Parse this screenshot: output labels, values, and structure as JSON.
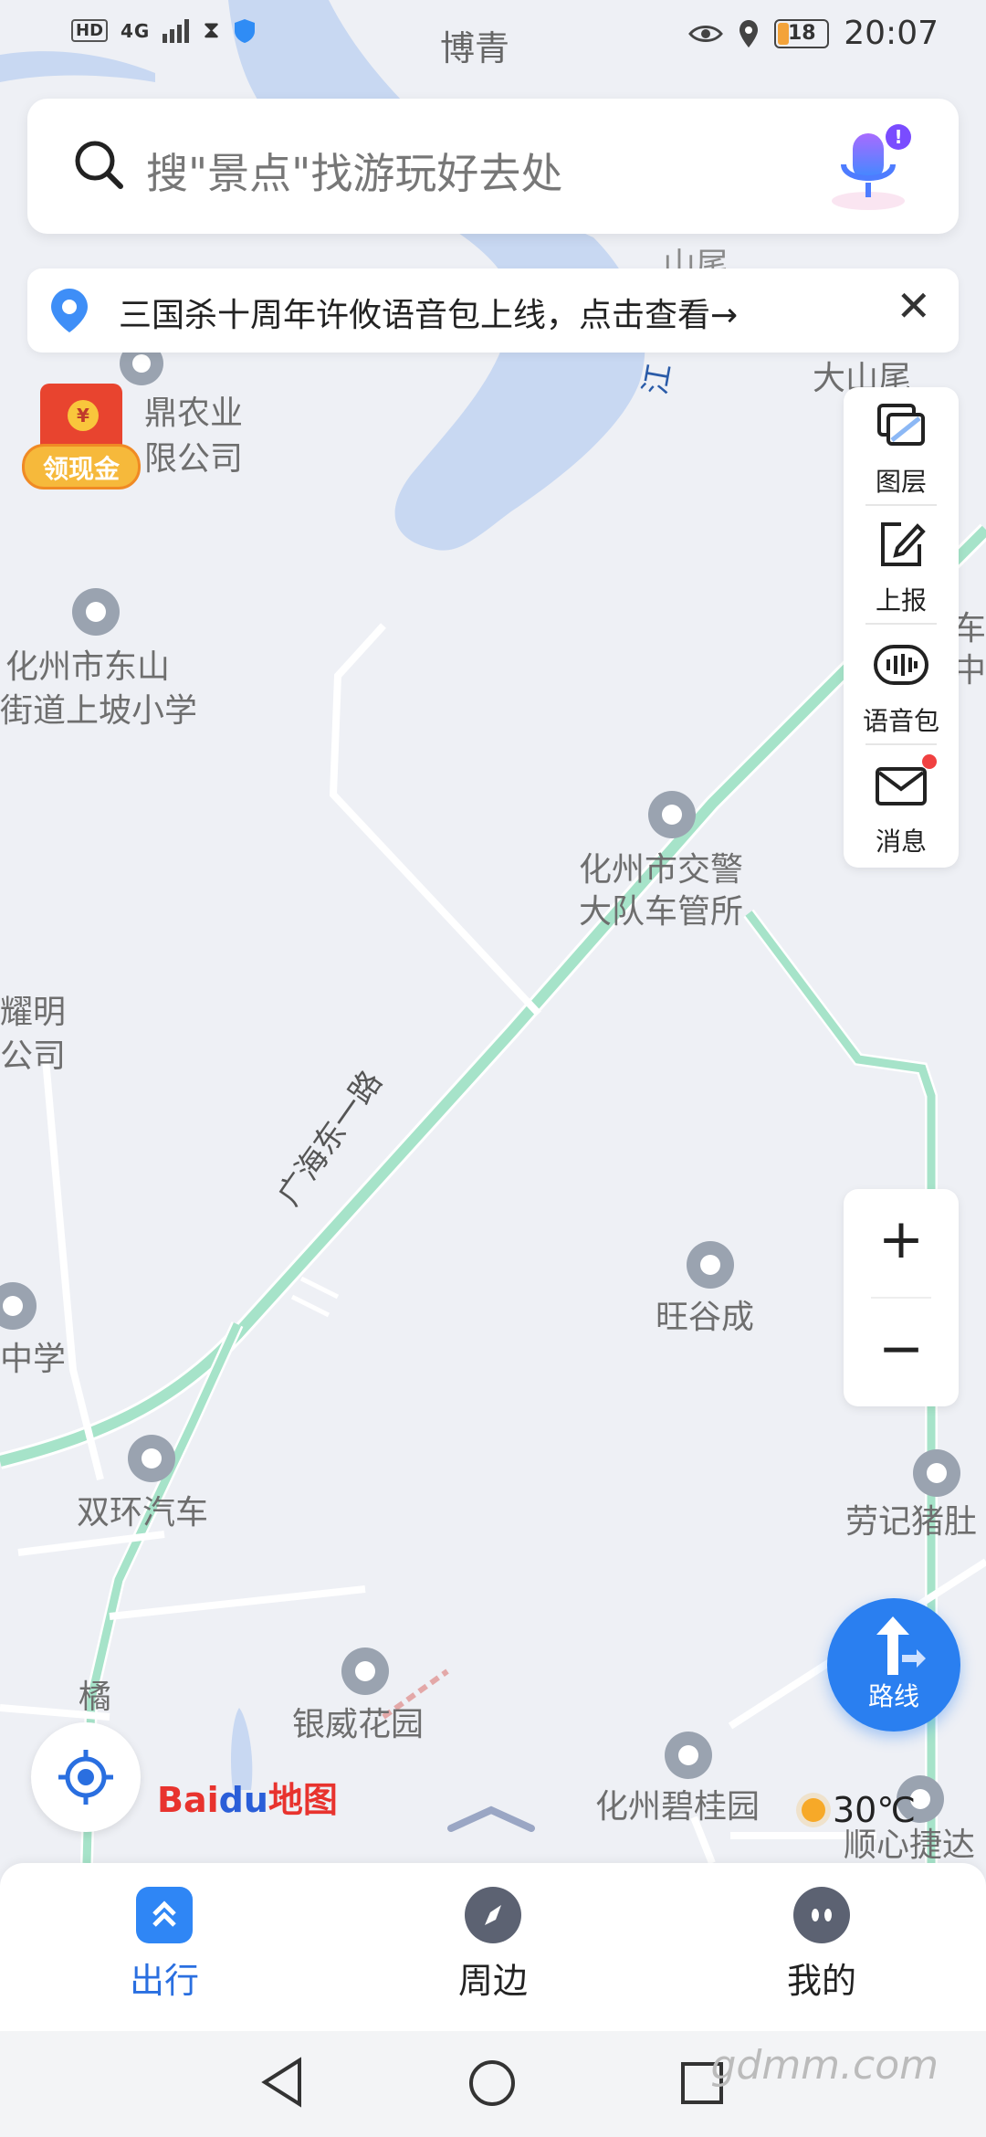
{
  "status_bar": {
    "hd": "HD",
    "network": "4G",
    "center": "博青",
    "battery": "18",
    "time": "20:07"
  },
  "search": {
    "placeholder": "搜\"景点\"找游玩好去处",
    "mic_badge": "!"
  },
  "notice": {
    "text": "三国杀十周年许攸语音包上线，点击查看→",
    "close": "✕"
  },
  "red_envelope": {
    "coin": "¥",
    "label": "领现金"
  },
  "tools": [
    {
      "label": "图层",
      "icon": "layers-icon"
    },
    {
      "label": "上报",
      "icon": "report-edit-icon"
    },
    {
      "label": "语音包",
      "icon": "voice-pack-icon"
    },
    {
      "label": "消息",
      "icon": "message-envelope-icon"
    }
  ],
  "zoom": {
    "plus": "+",
    "minus": "−"
  },
  "route": {
    "label": "路线"
  },
  "logo": {
    "bai": "Bai",
    "du": "du",
    "map": "地图"
  },
  "weather": {
    "temp": "30℃"
  },
  "map": {
    "places": [
      "山尾",
      "大山尾",
      "鼎农业",
      "限公司",
      "化州市东山",
      "街道上坡小学",
      "化州市交警",
      "大队车管所",
      "耀明",
      "公司",
      "中学",
      "旺谷成",
      "双环汽车",
      "劳记猪肚",
      "银威花园",
      "化州碧桂园",
      "橘",
      "顺心捷达",
      "车",
      "中"
    ],
    "road_name": "广海东一路",
    "river": "江"
  },
  "bottom_nav": [
    {
      "label": "出行",
      "active": true
    },
    {
      "label": "周边",
      "active": false
    },
    {
      "label": "我的",
      "active": false
    }
  ],
  "watermark": "gdmm.com",
  "colors": {
    "accent": "#2a6fe0",
    "river": "#c8d8f2",
    "main_road": "#a6e3c9",
    "map_bg": "#eef0f5"
  }
}
